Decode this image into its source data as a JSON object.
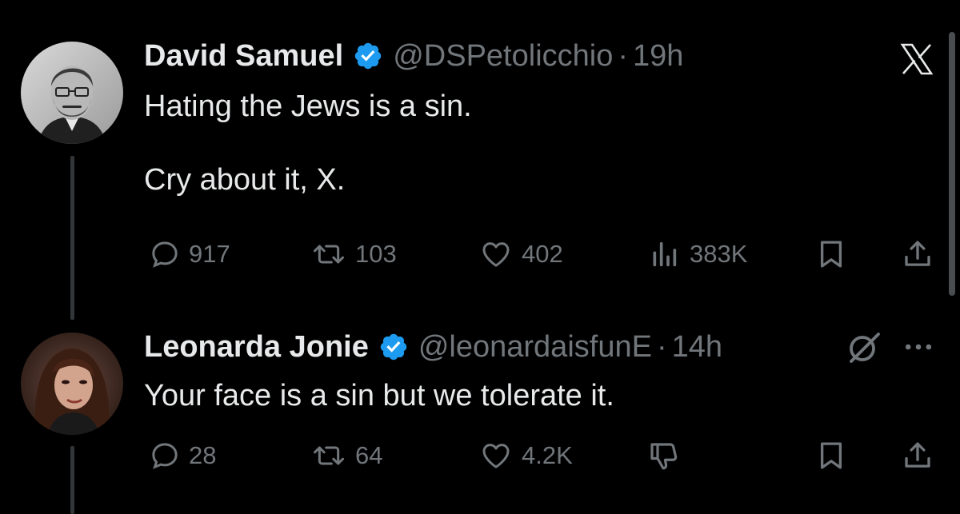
{
  "colors": {
    "background": "#000000",
    "text_primary": "#e7e9ea",
    "text_secondary": "#71767b",
    "verified_badge": "#1d9bf0"
  },
  "tweets": [
    {
      "display_name": "David Samuel",
      "handle": "@DSPetolicchio",
      "separator": "·",
      "time": "19h",
      "text": "Hating the Jews is a sin.\n\nCry about it, X.",
      "replies": "917",
      "reposts": "103",
      "likes": "402",
      "views": "383K",
      "top_right_icon": "x-logo-icon"
    },
    {
      "display_name": "Leonarda Jonie",
      "handle": "@leonardaisfunE",
      "separator": "·",
      "time": "14h",
      "text": "Your face is a sin but we tolerate it.",
      "replies": "28",
      "reposts": "64",
      "likes": "4.2K",
      "top_right_icons": [
        "grok-icon",
        "more-icon"
      ],
      "extra_action_icon": "dislike-icon"
    }
  ]
}
